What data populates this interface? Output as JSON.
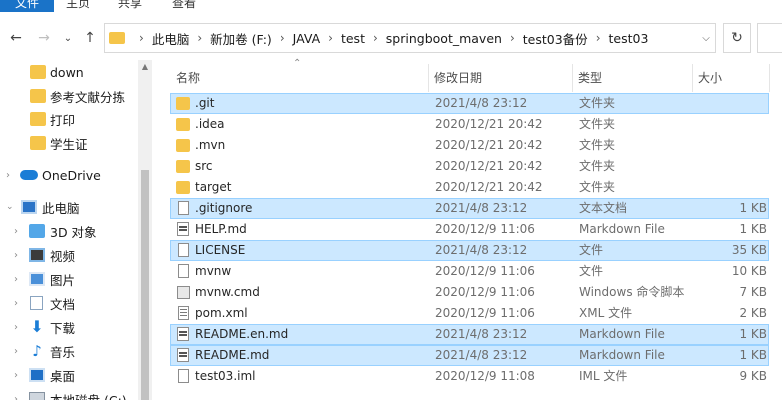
{
  "ribbon": {
    "tabs": [
      "文件",
      "主页",
      "共享",
      "查看"
    ]
  },
  "address": {
    "crumbs": [
      "此电脑",
      "新加卷 (F:)",
      "JAVA",
      "test",
      "springboot_maven",
      "test03备份",
      "test03"
    ]
  },
  "nav": {
    "back_icon": "back-arrow-icon",
    "forward_icon": "forward-arrow-icon",
    "recent_icon": "chevron-down-icon",
    "up_icon": "up-arrow-icon",
    "refresh_icon": "refresh-icon"
  },
  "sidebar": {
    "items": [
      {
        "label": "down",
        "icon": "folder-icon"
      },
      {
        "label": "参考文献分拣",
        "icon": "folder-icon"
      },
      {
        "label": "打印",
        "icon": "folder-icon"
      },
      {
        "label": "学生证",
        "icon": "folder-icon"
      },
      {
        "label": "OneDrive",
        "icon": "onedrive-icon"
      },
      {
        "label": "此电脑",
        "icon": "pc-icon"
      },
      {
        "label": "3D 对象",
        "icon": "3d-objects-icon"
      },
      {
        "label": "视频",
        "icon": "video-icon"
      },
      {
        "label": "图片",
        "icon": "pictures-icon"
      },
      {
        "label": "文档",
        "icon": "documents-icon"
      },
      {
        "label": "下载",
        "icon": "download-icon"
      },
      {
        "label": "音乐",
        "icon": "music-icon"
      },
      {
        "label": "桌面",
        "icon": "desktop-icon"
      },
      {
        "label": "本地磁盘 (C:)",
        "icon": "disk-icon"
      }
    ]
  },
  "columns": {
    "name": "名称",
    "date": "修改日期",
    "type": "类型",
    "size": "大小"
  },
  "files": [
    {
      "name": ".git",
      "date": "2021/4/8 23:12",
      "type": "文件夹",
      "size": "",
      "icon": "folder",
      "selected": true
    },
    {
      "name": ".idea",
      "date": "2020/12/21 20:42",
      "type": "文件夹",
      "size": "",
      "icon": "folder",
      "selected": false
    },
    {
      "name": ".mvn",
      "date": "2020/12/21 20:42",
      "type": "文件夹",
      "size": "",
      "icon": "folder",
      "selected": false
    },
    {
      "name": "src",
      "date": "2020/12/21 20:42",
      "type": "文件夹",
      "size": "",
      "icon": "folder",
      "selected": false
    },
    {
      "name": "target",
      "date": "2020/12/21 20:42",
      "type": "文件夹",
      "size": "",
      "icon": "folder",
      "selected": false
    },
    {
      "name": ".gitignore",
      "date": "2021/4/8 23:12",
      "type": "文本文档",
      "size": "1 KB",
      "icon": "txt",
      "selected": true
    },
    {
      "name": "HELP.md",
      "date": "2020/12/9 11:06",
      "type": "Markdown File",
      "size": "1 KB",
      "icon": "md",
      "selected": false
    },
    {
      "name": "LICENSE",
      "date": "2021/4/8 23:12",
      "type": "文件",
      "size": "35 KB",
      "icon": "file",
      "selected": true
    },
    {
      "name": "mvnw",
      "date": "2020/12/9 11:06",
      "type": "文件",
      "size": "10 KB",
      "icon": "file",
      "selected": false
    },
    {
      "name": "mvnw.cmd",
      "date": "2020/12/9 11:06",
      "type": "Windows 命令脚本",
      "size": "7 KB",
      "icon": "cmd",
      "selected": false
    },
    {
      "name": "pom.xml",
      "date": "2020/12/9 11:06",
      "type": "XML 文件",
      "size": "2 KB",
      "icon": "xml",
      "selected": false
    },
    {
      "name": "README.en.md",
      "date": "2021/4/8 23:12",
      "type": "Markdown File",
      "size": "1 KB",
      "icon": "md",
      "selected": true
    },
    {
      "name": "README.md",
      "date": "2021/4/8 23:12",
      "type": "Markdown File",
      "size": "1 KB",
      "icon": "md",
      "selected": true
    },
    {
      "name": "test03.iml",
      "date": "2020/12/9 11:08",
      "type": "IML 文件",
      "size": "9 KB",
      "icon": "file",
      "selected": false
    }
  ],
  "colors": {
    "selection_bg": "#cce8ff",
    "selection_border": "#99d1ff",
    "folder": "#f5c54a",
    "accent": "#1a73c8"
  }
}
